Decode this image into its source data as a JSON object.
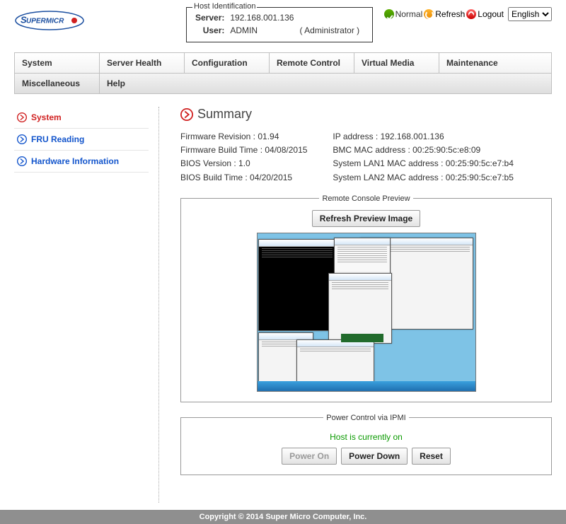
{
  "header": {
    "logo_text": "SUPERMICRO",
    "host_legend": "Host Identification",
    "server_label": "Server:",
    "server_value": "192.168.001.136",
    "user_label": "User:",
    "user_value": "ADMIN",
    "user_role": "( Administrator )",
    "status_label": "Normal",
    "refresh": "Refresh",
    "logout": "Logout",
    "language_selected": "English"
  },
  "menu": {
    "row1": [
      "System",
      "Server Health",
      "Configuration",
      "Remote Control",
      "Virtual Media",
      "Maintenance"
    ],
    "row2": [
      "Miscellaneous",
      "Help"
    ]
  },
  "sidebar": {
    "items": [
      {
        "label": "System",
        "active": true
      },
      {
        "label": "FRU Reading",
        "active": false
      },
      {
        "label": "Hardware Information",
        "active": false
      }
    ]
  },
  "summary": {
    "title": "Summary",
    "left": [
      "Firmware Revision : 01.94",
      "Firmware Build Time : 04/08/2015",
      "BIOS Version : 1.0",
      "BIOS Build Time : 04/20/2015"
    ],
    "right": [
      "IP address : 192.168.001.136",
      "BMC MAC address : 00:25:90:5c:e8:09",
      "System LAN1 MAC address : 00:25:90:5c:e7:b4",
      "System LAN2 MAC address : 00:25:90:5c:e7:b5"
    ]
  },
  "remote_console": {
    "legend": "Remote Console Preview",
    "refresh_button": "Refresh Preview Image"
  },
  "power": {
    "legend": "Power Control via IPMI",
    "status": "Host is currently on",
    "power_on": "Power On",
    "power_down": "Power Down",
    "reset": "Reset"
  },
  "footer": "Copyright © 2014 Super Micro Computer, Inc."
}
